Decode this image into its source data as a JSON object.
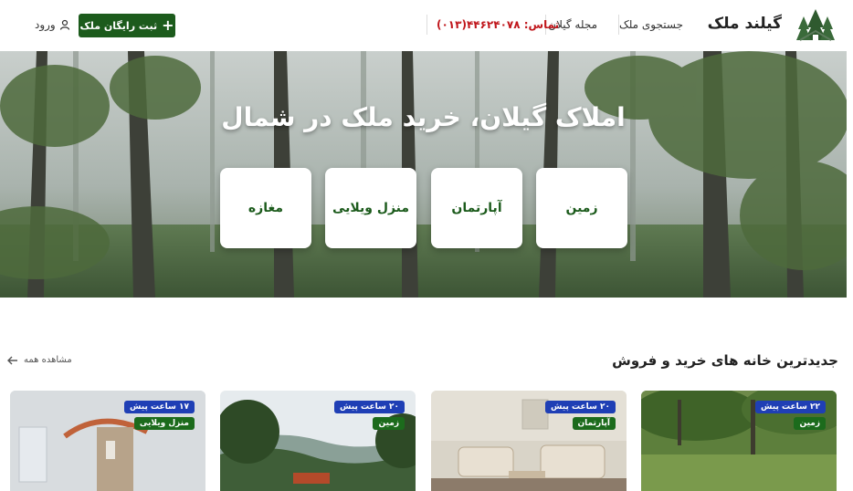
{
  "header": {
    "brand": "گیلند ملک",
    "nav": [
      "جستجوی ملک",
      "مجله گیلان"
    ],
    "contact": "تماس: ۴۴۶۲۴۰۷۸(۰۱۳)",
    "register_button": "ثبت رایگان ملک",
    "login": "ورود"
  },
  "hero": {
    "title": "املاک گیلان، خرید ملک در شمال",
    "categories": [
      "زمین",
      "آپارتمان",
      "منزل ویلایی",
      "مغازه"
    ]
  },
  "section": {
    "title": "جدیدترین خانه های خرید و فروش",
    "see_all": "مشاهده همه"
  },
  "listings": [
    {
      "time": "۲۲ ساعت پیش",
      "type": "زمین"
    },
    {
      "time": "۲۰ ساعت پیش",
      "type": "آپارتمان"
    },
    {
      "time": "۲۰ ساعت پیش",
      "type": "زمین"
    },
    {
      "time": "۱۷ ساعت پیش",
      "type": "منزل ویلایی"
    }
  ],
  "colors": {
    "primary_green": "#1c5b1c",
    "contact_red": "#c0161b",
    "time_badge_blue": "#1f3fb5"
  }
}
